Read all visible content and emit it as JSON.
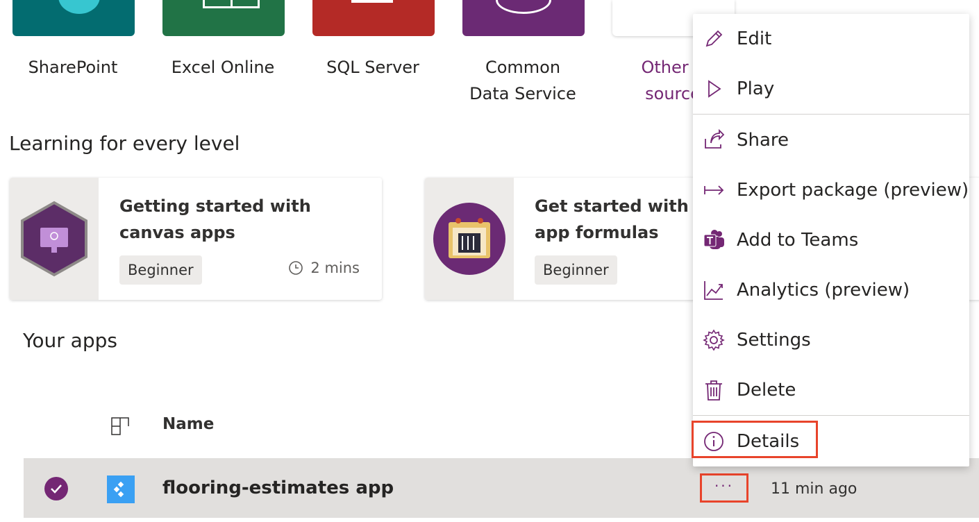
{
  "connectors": [
    {
      "label": "SharePoint",
      "color": "#036c70"
    },
    {
      "label": "Excel Online",
      "color": "#217346"
    },
    {
      "label": "SQL Server",
      "color": "#b42a26"
    },
    {
      "label": "Common Data Service",
      "line1": "Common",
      "line2": "Data Service",
      "color": "#6b2a74"
    },
    {
      "label": "Other data sources",
      "line1": "Other d",
      "line2": "source",
      "color": "#ffffff"
    }
  ],
  "learning": {
    "title": "Learning for every level",
    "cards": [
      {
        "title": "Getting started with canvas apps",
        "level": "Beginner",
        "duration": "2 mins"
      },
      {
        "title": "Get started with canvas app formulas",
        "title_line1": "Get started with ca",
        "title_line2": "app formulas",
        "level": "Beginner"
      }
    ]
  },
  "apps": {
    "title": "Your apps",
    "columns": {
      "name": "Name"
    },
    "rows": [
      {
        "name": "flooring-estimates app",
        "modified": "11 min ago",
        "more": "···"
      }
    ]
  },
  "context_menu": {
    "items": [
      {
        "label": "Edit",
        "icon": "pencil-icon"
      },
      {
        "label": "Play",
        "icon": "play-icon"
      },
      {
        "label": "Share",
        "icon": "share-icon"
      },
      {
        "label": "Export package (preview)",
        "icon": "export-icon"
      },
      {
        "label": "Add to Teams",
        "icon": "teams-icon"
      },
      {
        "label": "Analytics (preview)",
        "icon": "analytics-icon"
      },
      {
        "label": "Settings",
        "icon": "gear-icon"
      },
      {
        "label": "Delete",
        "icon": "trash-icon"
      },
      {
        "label": "Details",
        "icon": "info-icon"
      }
    ]
  },
  "colors": {
    "accent": "#742774",
    "highlight": "#e8442b"
  }
}
